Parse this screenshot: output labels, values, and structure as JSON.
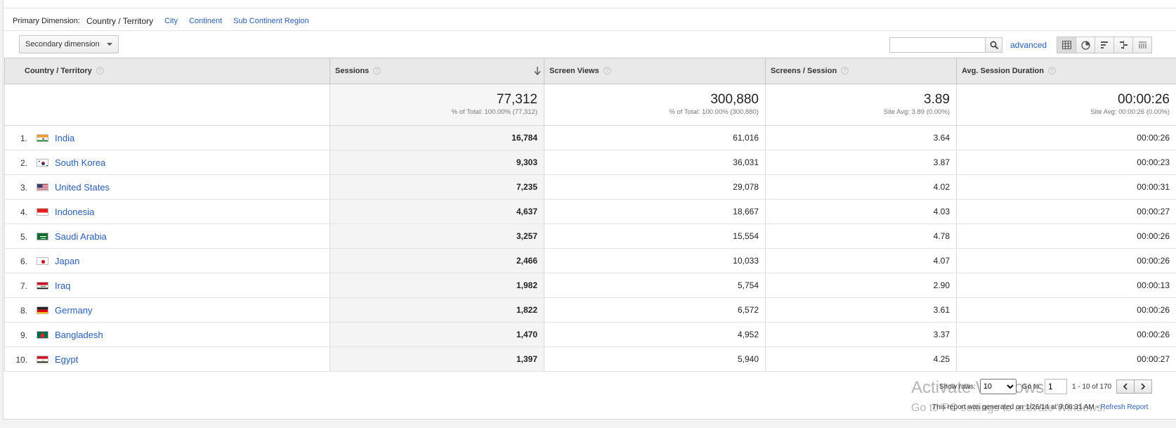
{
  "primary_dimension": {
    "label": "Primary Dimension:",
    "selected": "Country / Territory",
    "options": [
      "City",
      "Continent",
      "Sub Continent Region"
    ]
  },
  "toolbar": {
    "secondary_dimension": "Secondary dimension",
    "search_value": "",
    "advanced": "advanced"
  },
  "columns": {
    "country": "Country / Territory",
    "sessions": "Sessions",
    "screen_views": "Screen Views",
    "screens_per_session": "Screens / Session",
    "avg_session_duration": "Avg. Session Duration"
  },
  "totals": {
    "sessions": "77,312",
    "sessions_sub": "% of Total: 100.00% (77,312)",
    "screen_views": "300,880",
    "screen_views_sub": "% of Total: 100.00% (300,880)",
    "screens_per_session": "3.89",
    "screens_per_session_sub": "Site Avg: 3.89 (0.00%)",
    "avg_session_duration": "00:00:26",
    "avg_session_duration_sub": "Site Avg: 00:00:26 (0.00%)"
  },
  "rows": [
    {
      "rank": "1.",
      "country": "India",
      "flag": "india",
      "sessions": "16,784",
      "screen_views": "61,016",
      "sps": "3.64",
      "duration": "00:00:26"
    },
    {
      "rank": "2.",
      "country": "South Korea",
      "flag": "south-korea",
      "sessions": "9,303",
      "screen_views": "36,031",
      "sps": "3.87",
      "duration": "00:00:23"
    },
    {
      "rank": "3.",
      "country": "United States",
      "flag": "united-states",
      "sessions": "7,235",
      "screen_views": "29,078",
      "sps": "4.02",
      "duration": "00:00:31"
    },
    {
      "rank": "4.",
      "country": "Indonesia",
      "flag": "indonesia",
      "sessions": "4,637",
      "screen_views": "18,667",
      "sps": "4.03",
      "duration": "00:00:27"
    },
    {
      "rank": "5.",
      "country": "Saudi Arabia",
      "flag": "saudi-arabia",
      "sessions": "3,257",
      "screen_views": "15,554",
      "sps": "4.78",
      "duration": "00:00:26"
    },
    {
      "rank": "6.",
      "country": "Japan",
      "flag": "japan",
      "sessions": "2,466",
      "screen_views": "10,033",
      "sps": "4.07",
      "duration": "00:00:26"
    },
    {
      "rank": "7.",
      "country": "Iraq",
      "flag": "iraq",
      "sessions": "1,982",
      "screen_views": "5,754",
      "sps": "2.90",
      "duration": "00:00:13"
    },
    {
      "rank": "8.",
      "country": "Germany",
      "flag": "germany",
      "sessions": "1,822",
      "screen_views": "6,572",
      "sps": "3.61",
      "duration": "00:00:26"
    },
    {
      "rank": "9.",
      "country": "Bangladesh",
      "flag": "bangladesh",
      "sessions": "1,470",
      "screen_views": "4,952",
      "sps": "3.37",
      "duration": "00:00:26"
    },
    {
      "rank": "10.",
      "country": "Egypt",
      "flag": "egypt",
      "sessions": "1,397",
      "screen_views": "5,940",
      "sps": "4.25",
      "duration": "00:00:27"
    }
  ],
  "pager": {
    "show_rows_label": "Show rows:",
    "show_rows_value": "10",
    "goto_label": "Go to:",
    "goto_value": "1",
    "range": "1 - 10 of 170"
  },
  "footer": {
    "generated": "This report was generated on 1/26/14 at 9:06:31 AM - ",
    "refresh": "Refresh Report"
  },
  "watermark": {
    "line1": "Activate Windows",
    "line2": "Go to PC settings to activate Windows."
  }
}
